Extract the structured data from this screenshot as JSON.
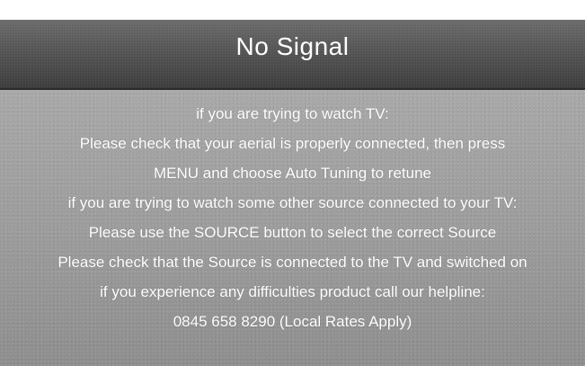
{
  "osd": {
    "title": "No Signal",
    "lines": [
      "if you are trying to watch TV:",
      "Please check that your aerial is properly connected, then press",
      "MENU and choose Auto Tuning to retune",
      "if you are trying to watch some other source connected to your TV:",
      "Please use the SOURCE button to select the correct Source",
      "Please check that the Source is connected to the TV and switched on",
      "if you experience any difficulties product call our helpline:",
      "0845 658 8290 (Local Rates Apply)"
    ]
  },
  "colors": {
    "title_bar": "#565656",
    "body_panel": "#9c9c9c",
    "text": "#ffffff"
  }
}
